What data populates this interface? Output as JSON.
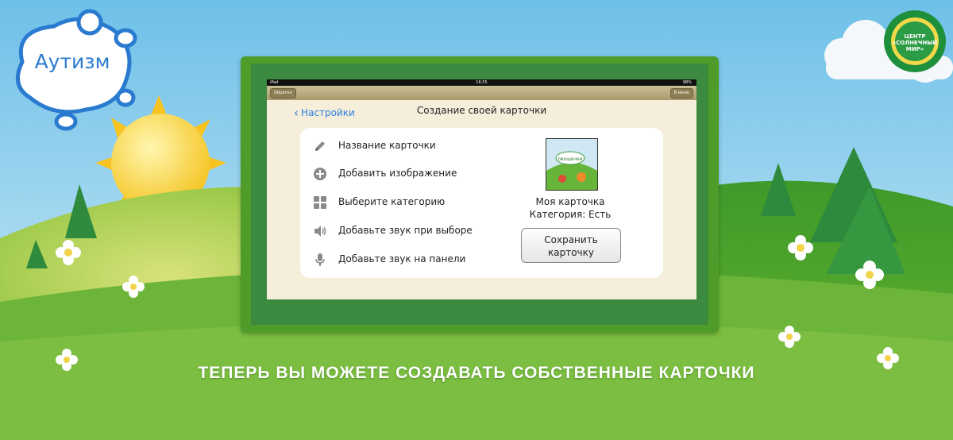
{
  "logo": {
    "text": "Аутизм"
  },
  "seal": {
    "text": "ЦЕНТР «СОЛНЕЧНЫЙ МИР»"
  },
  "device": {
    "status": {
      "carrier": "iPad",
      "time": "16:55",
      "battery": "98%"
    },
    "toolbar": {
      "left_label": "Обратно",
      "right_label": "В меню"
    },
    "nav": {
      "back_label": "Настройки",
      "title": "Создание своей карточки"
    },
    "menu": [
      {
        "label": "Название карточки",
        "icon": "pencil-icon"
      },
      {
        "label": "Добавить изображение",
        "icon": "plus-circle-icon"
      },
      {
        "label": "Выберите категорию",
        "icon": "grid-icon"
      },
      {
        "label": "Добавьте звук при выборе",
        "icon": "speaker-icon"
      },
      {
        "label": "Добавьте звук на панели",
        "icon": "microphone-icon"
      }
    ],
    "preview": {
      "thumb_label": "овощечки",
      "name": "Моя карточка",
      "category": "Категория: Есть",
      "save_line1": "Сохранить",
      "save_line2": "карточку"
    }
  },
  "headline": "ТЕПЕРЬ ВЫ МОЖЕТЕ СОЗДАВАТЬ СОБСТВЕННЫЕ КАРТОЧКИ",
  "colors": {
    "accent": "#2f7fe0",
    "frame": "#4f9c2a",
    "screen_bg": "#f4eedb",
    "grass": "#5aa82a"
  }
}
